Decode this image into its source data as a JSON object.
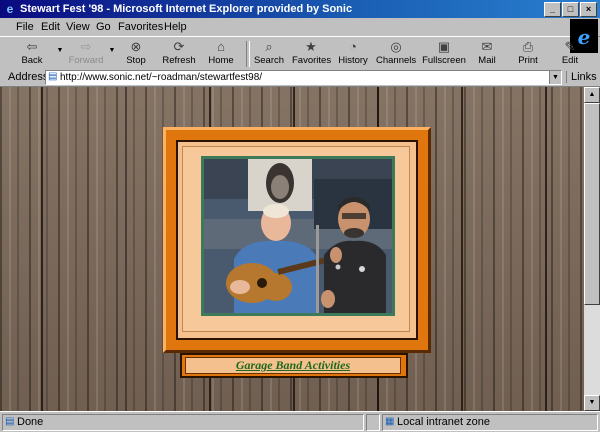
{
  "window": {
    "title": "Stewart Fest '98 - Microsoft Internet Explorer provided by Sonic"
  },
  "menu": [
    "File",
    "Edit",
    "View",
    "Go",
    "Favorites",
    "Help"
  ],
  "toolbar": [
    {
      "label": "Back",
      "icon": "back-arrow-icon"
    },
    {
      "label": "Forward",
      "icon": "forward-arrow-icon"
    },
    {
      "label": "Stop",
      "icon": "stop-icon"
    },
    {
      "label": "Refresh",
      "icon": "refresh-icon"
    },
    {
      "label": "Home",
      "icon": "home-icon"
    },
    {
      "label": "Search",
      "icon": "search-icon"
    },
    {
      "label": "Favorites",
      "icon": "favorites-icon"
    },
    {
      "label": "History",
      "icon": "history-icon"
    },
    {
      "label": "Channels",
      "icon": "channels-icon"
    },
    {
      "label": "Fullscreen",
      "icon": "fullscreen-icon"
    },
    {
      "label": "Mail",
      "icon": "mail-icon"
    },
    {
      "label": "Print",
      "icon": "print-icon"
    },
    {
      "label": "Edit",
      "icon": "edit-icon"
    }
  ],
  "address": {
    "label": "Address",
    "url": "http://www.sonic.net/~roadman/stewartfest98/",
    "links_label": "Links"
  },
  "page": {
    "caption": "Garage Band Activities"
  },
  "status": {
    "text": "Done",
    "zone": "Local intranet zone"
  },
  "colors": {
    "frame_orange": "#e0760e",
    "matte": "#f7c89a",
    "caption_text": "#1d6a1d",
    "titlebar": "#0a0a80"
  }
}
